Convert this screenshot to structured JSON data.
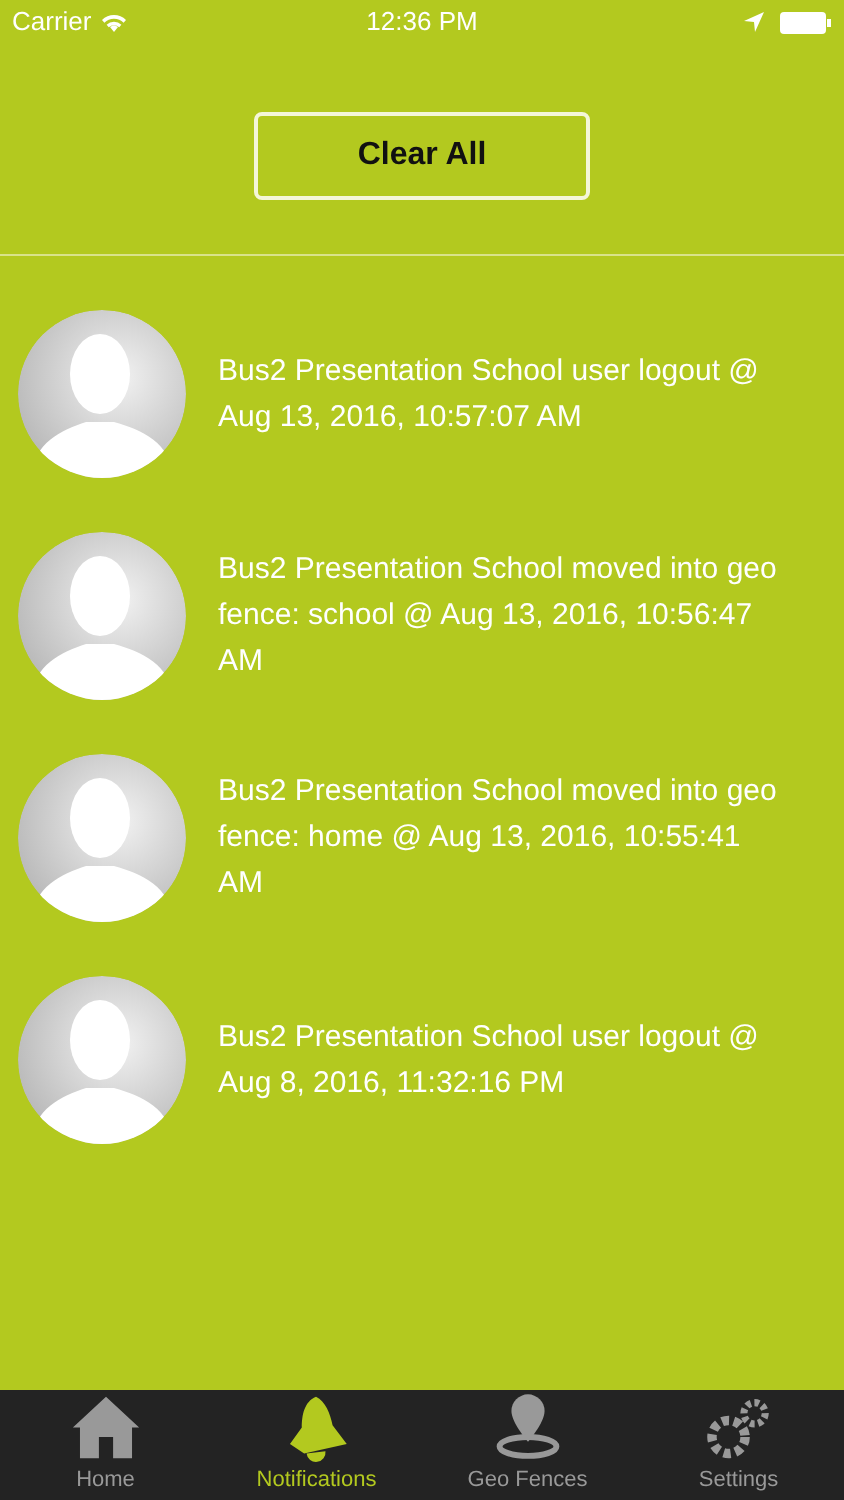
{
  "status_bar": {
    "carrier": "Carrier",
    "time": "12:36 PM"
  },
  "clear_button": {
    "label": "Clear All"
  },
  "notifications": [
    {
      "text": "Bus2 Presentation School user logout @ Aug 13, 2016, 10:57:07 AM"
    },
    {
      "text": "Bus2 Presentation School moved into geo fence: school @ Aug 13, 2016, 10:56:47 AM"
    },
    {
      "text": "Bus2 Presentation School moved into geo fence: home @ Aug 13, 2016, 10:55:41 AM"
    },
    {
      "text": "Bus2 Presentation School user logout @ Aug 8, 2016, 11:32:16 PM"
    }
  ],
  "tabs": [
    {
      "label": "Home",
      "kind": "home",
      "selected": false
    },
    {
      "label": "Notifications",
      "kind": "bell",
      "selected": true
    },
    {
      "label": "Geo Fences",
      "kind": "pin",
      "selected": false
    },
    {
      "label": "Settings",
      "kind": "gears",
      "selected": false
    }
  ]
}
